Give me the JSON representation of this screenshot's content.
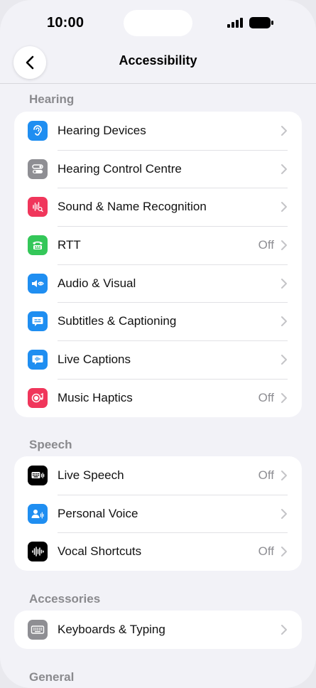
{
  "status_bar": {
    "time": "10:00"
  },
  "nav": {
    "title": "Accessibility"
  },
  "sections": {
    "hearing": {
      "header": "Hearing",
      "items": [
        {
          "label": "Hearing Devices",
          "value": "",
          "icon": "ear-icon",
          "color": "#1f8ef1"
        },
        {
          "label": "Hearing Control Centre",
          "value": "",
          "icon": "toggle-switches-icon",
          "color": "#8e8e93"
        },
        {
          "label": "Sound & Name Recognition",
          "value": "",
          "icon": "sound-recognition-icon",
          "color": "#f0365b"
        },
        {
          "label": "RTT",
          "value": "Off",
          "icon": "teletype-icon",
          "color": "#34c759"
        },
        {
          "label": "Audio & Visual",
          "value": "",
          "icon": "audio-visual-icon",
          "color": "#1f8ef1"
        },
        {
          "label": "Subtitles & Captioning",
          "value": "",
          "icon": "subtitles-icon",
          "color": "#1f8ef1"
        },
        {
          "label": "Live Captions",
          "value": "",
          "icon": "live-captions-icon",
          "color": "#1f8ef1"
        },
        {
          "label": "Music Haptics",
          "value": "Off",
          "icon": "music-haptics-icon",
          "color": "#f0365b"
        }
      ]
    },
    "speech": {
      "header": "Speech",
      "items": [
        {
          "label": "Live Speech",
          "value": "Off",
          "icon": "keyboard-speech-icon",
          "color": "#000000"
        },
        {
          "label": "Personal Voice",
          "value": "",
          "icon": "personal-voice-icon",
          "color": "#1f8ef1"
        },
        {
          "label": "Vocal Shortcuts",
          "value": "Off",
          "icon": "waveform-icon",
          "color": "#000000"
        }
      ]
    },
    "accessories": {
      "header": "Accessories",
      "items": [
        {
          "label": "Keyboards & Typing",
          "value": "",
          "icon": "keyboard-icon",
          "color": "#8e8e93"
        }
      ]
    },
    "general": {
      "header": "General"
    }
  }
}
